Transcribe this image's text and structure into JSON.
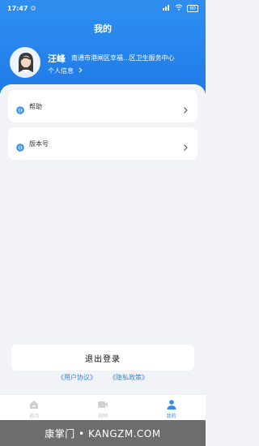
{
  "status_bar": {
    "time": "17:47",
    "battery": "80"
  },
  "header": {
    "title": "我的"
  },
  "profile": {
    "name": "汪峰",
    "org": "南通市港闸区幸福...区卫生服务中心",
    "link_label": "个人信息"
  },
  "menu": {
    "items": [
      {
        "label": "帮助",
        "icon": "info-circle-icon"
      },
      {
        "label": "版本号",
        "icon": "info-circle-icon"
      }
    ]
  },
  "actions": {
    "logout_label": "退出登录"
  },
  "legal": {
    "user_agreement": "《用户协议》",
    "privacy_policy": "《隐私政策》"
  },
  "tabbar": {
    "tabs": [
      {
        "label": "首页",
        "icon": "home-icon",
        "active": false
      },
      {
        "label": "视频",
        "icon": "video-icon",
        "active": false
      },
      {
        "label": "我的",
        "icon": "person-icon",
        "active": true
      }
    ]
  },
  "watermark": {
    "text": "康掌门 • KANGZM.COM"
  },
  "colors": {
    "primary": "#2f8ff0",
    "background": "#f2f3f7",
    "link": "#2f85df"
  }
}
